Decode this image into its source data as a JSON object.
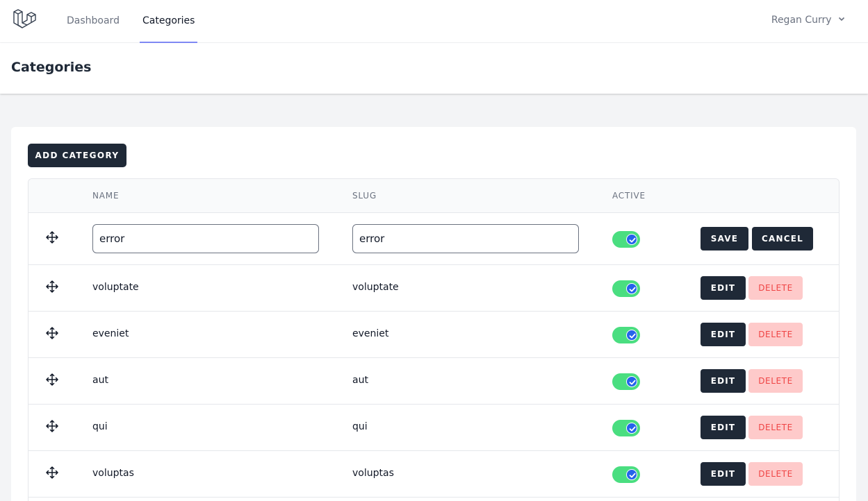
{
  "nav": {
    "links": [
      {
        "label": "Dashboard",
        "active": false
      },
      {
        "label": "Categories",
        "active": true
      }
    ],
    "user_name": "Regan Curry"
  },
  "page": {
    "title": "Categories"
  },
  "toolbar": {
    "add_label": "ADD CATEGORY"
  },
  "table": {
    "columns": [
      "NAME",
      "SLUG",
      "ACTIVE",
      ""
    ],
    "editing_row": {
      "name_value": "error",
      "slug_value": "error",
      "active": true,
      "save_label": "SAVE",
      "cancel_label": "CANCEL"
    },
    "rows": [
      {
        "name": "voluptate",
        "slug": "voluptate",
        "active": true
      },
      {
        "name": "eveniet",
        "slug": "eveniet",
        "active": true
      },
      {
        "name": "aut",
        "slug": "aut",
        "active": true
      },
      {
        "name": "qui",
        "slug": "qui",
        "active": true
      },
      {
        "name": "voluptas",
        "slug": "voluptas",
        "active": true
      }
    ],
    "edit_label": "EDIT",
    "delete_label": "DELETE"
  },
  "colors": {
    "accent": "#818cf8",
    "dark_button": "#1f2937",
    "toggle_on": "#4ade80",
    "toggle_knob": "#2563eb",
    "delete_bg": "#fecaca",
    "delete_text": "#ef4444"
  },
  "icons": {
    "logo": "laravel-logo-icon",
    "move": "move-arrows-icon",
    "chevron": "chevron-down-icon",
    "check": "check-icon"
  }
}
